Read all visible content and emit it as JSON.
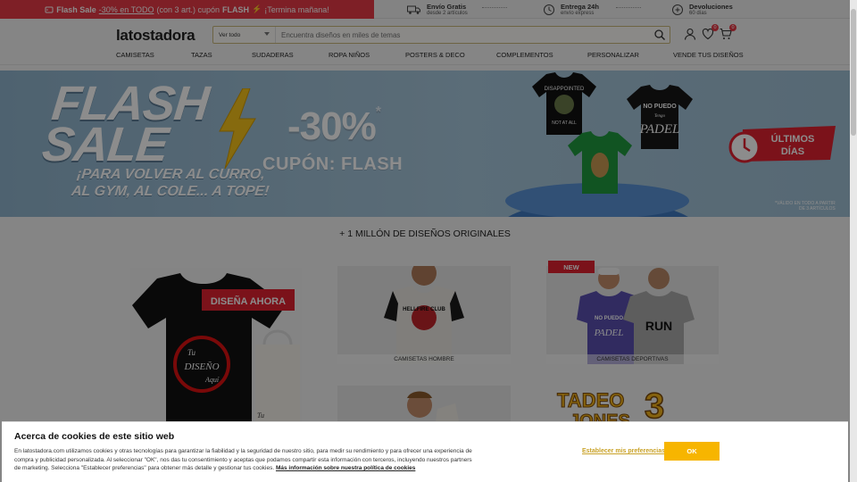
{
  "topbar": {
    "promo": {
      "part1": "Flash Sale",
      "part2": "-30% en TODO",
      "part3": "(con 3 art.) cupón",
      "part4": "FLASH",
      "part5": "¡Termina mañana!"
    },
    "shipping": {
      "title": "Envío Gratis",
      "sub": "desde 2 artículos"
    },
    "delivery": {
      "title": "Entrega 24h",
      "sub": "envío express"
    },
    "returns": {
      "title": "Devoluciones",
      "sub": "60 días"
    }
  },
  "header": {
    "logo": "latostadora",
    "search": {
      "select": "Ver todo",
      "placeholder": "Encuentra diseños en miles de temas"
    },
    "wishlist_count": "0",
    "cart_count": "0"
  },
  "nav": [
    "CAMISETAS",
    "TAZAS",
    "SUDADERAS",
    "ROPA NIÑOS",
    "POSTERS & DECO",
    "COMPLEMENTOS",
    "PERSONALIZAR",
    "VENDE TUS DISEÑOS"
  ],
  "hero": {
    "flash1": "FLASH",
    "flash2": "SALE",
    "sub1": "¡PARA VOLVER AL CURRO,",
    "sub2": "AL GYM, AL COLE... A TOPE!",
    "pct": "-30%",
    "star": "*",
    "coupon": "CUPÓN: FLASH",
    "shirt1_text": "DISAPPOINTED",
    "shirt1_text2": "NOT AT ALL",
    "shirt2_text": "NO PUEDO",
    "shirt2_text2": "Tengo",
    "shirt2_text3": "PADEL",
    "ultimos": "ÚLTIMOS",
    "dias": "DÍAS",
    "note1": "*VÁLIDO EN TODO A PARTIR",
    "note2": "DE 3 ARTÍCULOS"
  },
  "section_title": "+ 1 MILLÓN DE DISEÑOS ORIGINALES",
  "tiles": {
    "design": {
      "label": "DISEÑA AHORA",
      "shirt_text1": "Tu",
      "shirt_text2": "DISEÑO",
      "shirt_text3": "Aquí",
      "bag_text": "Tu"
    },
    "men": {
      "caption": "CAMISETAS HOMBRE",
      "shirt_text": "HELLFIRE CLUB"
    },
    "sport": {
      "badge": "NEW",
      "caption": "CAMISETAS DEPORTIVAS",
      "shirt_text1": "NO PUEDO",
      "shirt_text2": "PADEL",
      "shirt_text3": "RUN"
    },
    "tadeo": {
      "text": "TADEO",
      "text2": "JONES",
      "num": "3"
    }
  },
  "cookie": {
    "title": "Acerca de cookies de este sitio web",
    "body": "En latostadora.com utilizamos cookies y otras tecnologías para garantizar la fiabilidad y la seguridad de nuestro sitio, para medir su rendimiento y para ofrecer una experiencia de compra y publicidad personalizada. Al seleccionar \"OK\", nos das tu consentimiento y aceptas que podamos compartir esta información con terceros, incluyendo nuestros partners de marketing. Selecciona \"Establecer preferencias\" para obtener más detalle y gestionar tus cookies.",
    "link": "Más información sobre nuestra política de cookies",
    "prefs": "Establecer mis preferencias",
    "ok": "OK"
  }
}
